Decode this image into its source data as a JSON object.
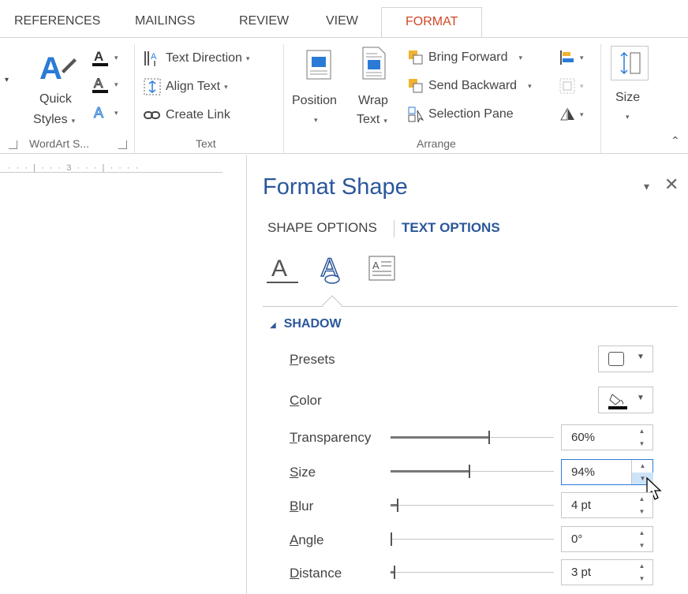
{
  "tabs": [
    {
      "label": "REFERENCES"
    },
    {
      "label": "MAILINGS"
    },
    {
      "label": "REVIEW"
    },
    {
      "label": "VIEW"
    },
    {
      "label": "FORMAT",
      "active": true
    }
  ],
  "ribbon": {
    "wordart": {
      "quick_styles_label_1": "Quick",
      "quick_styles_label_2": "Styles",
      "group_label": "WordArt S..."
    },
    "text": {
      "text_direction": "Text Direction",
      "align_text": "Align Text",
      "create_link": "Create Link",
      "group_label": "Text"
    },
    "arrange": {
      "position": "Position",
      "wrap_1": "Wrap",
      "wrap_2": "Text",
      "bring_forward": "Bring Forward",
      "send_backward": "Send Backward",
      "selection_pane": "Selection Pane",
      "group_label": "Arrange"
    },
    "size": {
      "label": "Size"
    }
  },
  "ruler": {
    "text": "· · · | · · · 3 · · · | · · · ·"
  },
  "pane": {
    "title": "Format Shape",
    "shape_options": "SHAPE OPTIONS",
    "text_options": "TEXT OPTIONS",
    "section": "SHADOW",
    "properties": [
      {
        "label_u": "P",
        "label_rest": "resets",
        "kind": "dropdown"
      },
      {
        "label_u": "C",
        "label_rest": "olor",
        "kind": "color"
      },
      {
        "label_u": "T",
        "label_rest": "ransparency",
        "kind": "spin",
        "value": "60%",
        "level": 0.6
      },
      {
        "label_u": "S",
        "label_rest": "ize",
        "kind": "spin",
        "value": "94%",
        "level": 0.48
      },
      {
        "label_u": "B",
        "label_rest": "lur",
        "kind": "spin",
        "value": "4 pt",
        "level": 0.04
      },
      {
        "label_u": "A",
        "label_rest": "ngle",
        "kind": "spin",
        "value": "0°",
        "level": 0.0
      },
      {
        "label_u": "D",
        "label_rest": "istance",
        "kind": "spin",
        "value": "3 pt",
        "level": 0.02
      }
    ]
  },
  "colors": {
    "accent_blue": "#2b579a",
    "format_tab_orange": "#d24726",
    "focus_blue": "#2b7bd6"
  },
  "icons": [
    "wordart-a-icon",
    "text-fill-icon",
    "text-outline-icon",
    "text-effects-icon",
    "text-direction-icon",
    "align-text-icon",
    "link-icon",
    "position-icon",
    "wrap-text-icon",
    "bring-forward-icon",
    "send-backward-icon",
    "selection-pane-icon",
    "align-icon",
    "group-icon",
    "rotate-icon",
    "size-icon",
    "close-icon",
    "collapse-ribbon-icon",
    "text-fill-outline-icon",
    "text-effects-tab-icon",
    "textbox-icon",
    "paint-bucket-icon",
    "mouse-cursor-icon"
  ]
}
